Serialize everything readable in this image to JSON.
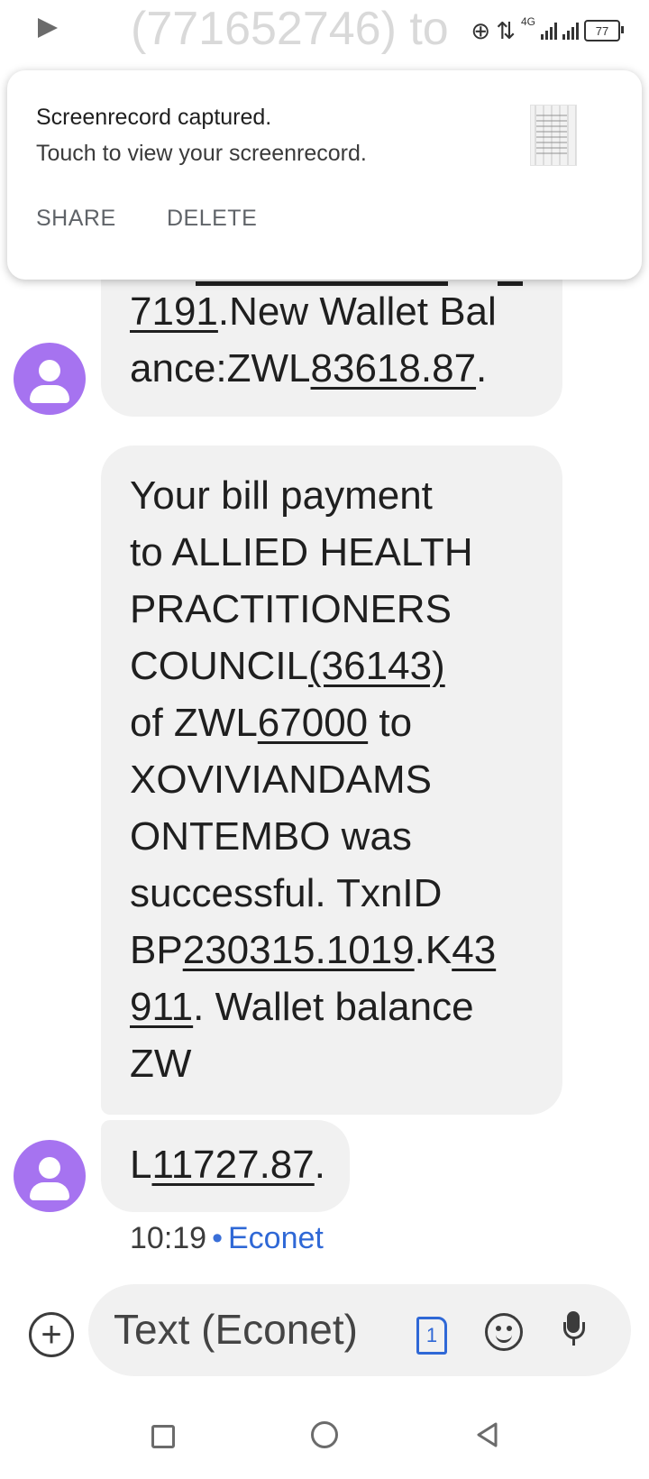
{
  "status_bar": {
    "background_text": "(771652746) to",
    "network": "4G",
    "battery": "77"
  },
  "notification": {
    "title": "Screenrecord captured.",
    "body": "Touch to view your screenrecord.",
    "actions": [
      "SHARE",
      "DELETE"
    ]
  },
  "messages": [
    {
      "lines": [
        [
          {
            "t": "7191",
            "u": true
          },
          {
            "t": ".New Wallet Bal",
            "u": false
          }
        ],
        [
          {
            "t": "ance:ZWL",
            "u": false
          },
          {
            "t": "83618.87",
            "u": true
          },
          {
            "t": ".",
            "u": false
          }
        ]
      ]
    },
    {
      "lines": [
        [
          {
            "t": "Your bill payment",
            "u": false
          }
        ],
        [
          {
            "t": "to ALLIED HEALTH",
            "u": false
          }
        ],
        [
          {
            "t": "PRACTITIONERS",
            "u": false
          }
        ],
        [
          {
            "t": "COUNCIL",
            "u": false
          },
          {
            "t": "(36143)",
            "u": true
          }
        ],
        [
          {
            "t": "of ZWL",
            "u": false
          },
          {
            "t": "67000",
            "u": true
          },
          {
            "t": " to",
            "u": false
          }
        ],
        [
          {
            "t": "XOVIVIANDAMS",
            "u": false
          }
        ],
        [
          {
            "t": "ONTEMBO was",
            "u": false
          }
        ],
        [
          {
            "t": "successful. TxnID",
            "u": false
          }
        ],
        [
          {
            "t": "BP",
            "u": false
          },
          {
            "t": "230315.1019",
            "u": true
          },
          {
            "t": ".K",
            "u": false
          },
          {
            "t": "43",
            "u": true
          }
        ],
        [
          {
            "t": "911",
            "u": true
          },
          {
            "t": ". Wallet balance",
            "u": false
          }
        ],
        [
          {
            "t": "ZW",
            "u": false
          }
        ]
      ]
    },
    {
      "lines": [
        [
          {
            "t": "L",
            "u": false
          },
          {
            "t": "11727.87",
            "u": true
          },
          {
            "t": ".",
            "u": false
          }
        ]
      ]
    }
  ],
  "meta": {
    "time": "10:19",
    "separator": "•",
    "sender": "Econet"
  },
  "compose": {
    "placeholder": "Text (Econet)",
    "sim_number": "1"
  },
  "colors": {
    "avatar": "#a673f0",
    "bubble": "#f1f1f1",
    "link": "#2f68d6"
  }
}
